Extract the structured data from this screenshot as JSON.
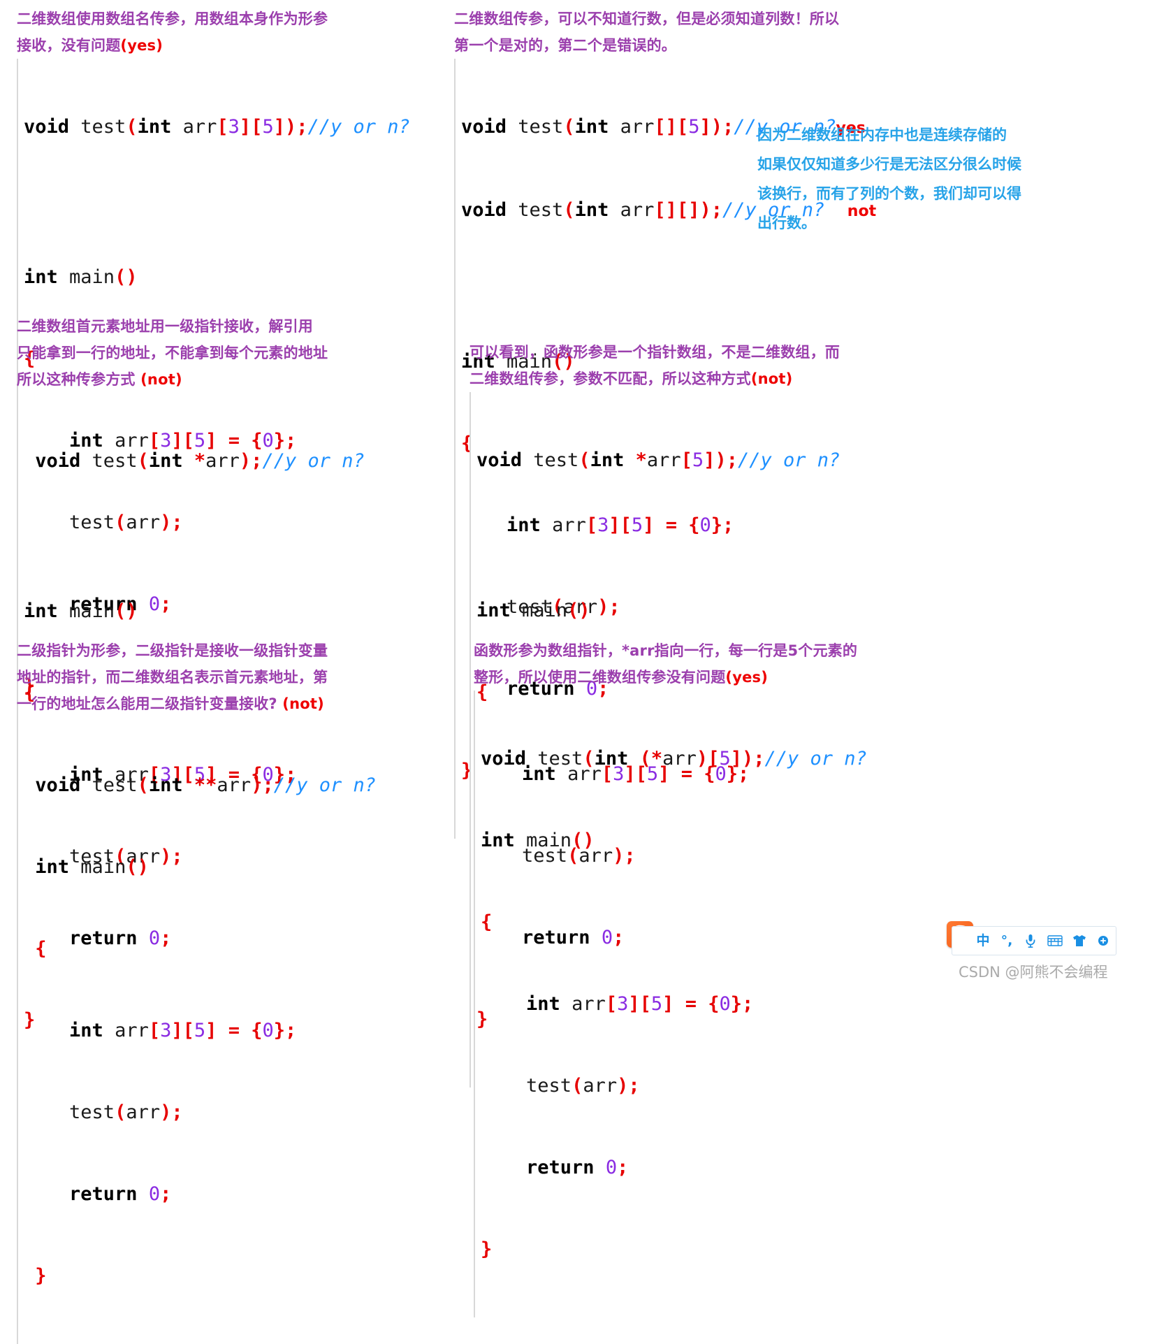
{
  "panels": [
    {
      "id": "top-left",
      "notes": [
        "二维数组使用数组名传参，用数组本身作为形参",
        "接收，没有问题"
      ],
      "note_tag": "(yes)",
      "signature": {
        "kw1": "void",
        "name": " test",
        "open": "(",
        "kw2": "int",
        "arg": " arr",
        "b1": "[",
        "n1": "3",
        "b2": "]",
        "b3": "[",
        "n2": "5",
        "b4": "]",
        "close": ");",
        "comment": "//y or n?"
      },
      "answer": "",
      "body": {
        "main_kw": "int",
        "main_name": " main",
        "main_paren": "()",
        "brace_open": "{",
        "decl_kw": "int",
        "decl_name": " arr",
        "decl_b1": "[",
        "decl_n1": "3",
        "decl_b2": "]",
        "decl_b3": "[",
        "decl_n2": "5",
        "decl_b4": "]",
        "decl_eq": " = ",
        "decl_init_open": "{",
        "decl_zero": "0",
        "decl_init_close": "};",
        "call_name": "test",
        "call_open": "(",
        "call_arg": "arr",
        "call_close": ");",
        "ret_kw": "return",
        "ret_val": " 0",
        "ret_semi": ";",
        "brace_close": "}"
      }
    },
    {
      "id": "top-right",
      "notes": [
        "二维数组传参，可以不知道行数，但是必须知道列数！所以",
        "第一个是对的，第二个是错误的。"
      ],
      "note_tag": "",
      "signature": {
        "kw1": "void",
        "name": " test",
        "open": "(",
        "kw2": "int",
        "arg": " arr",
        "b1": "[",
        "n1": "",
        "b2": "]",
        "b3": "[",
        "n2": "5",
        "b4": "]",
        "close": ");",
        "comment": "//y or n?"
      },
      "answer": "yes",
      "signature2": {
        "kw1": "void",
        "name": " test",
        "open": "(",
        "kw2": "int",
        "arg": " arr",
        "b1": "[",
        "n1": "",
        "b2": "]",
        "b3": "[",
        "n2": "",
        "b4": "]",
        "close": ");",
        "comment": "//y or n?"
      },
      "answer2": "not",
      "body": {
        "main_kw": "int",
        "main_name": " main",
        "main_paren": "()",
        "brace_open": "{",
        "decl_kw": "int",
        "decl_name": " arr",
        "decl_b1": "[",
        "decl_n1": "3",
        "decl_b2": "]",
        "decl_b3": "[",
        "decl_n2": "5",
        "decl_b4": "]",
        "decl_eq": " = ",
        "decl_init_open": "{",
        "decl_zero": "0",
        "decl_init_close": "};",
        "call_name": "test",
        "call_open": "(",
        "call_arg": "arr",
        "call_close": ");",
        "ret_kw": "return",
        "ret_val": " 0",
        "ret_semi": ";",
        "brace_close": "}"
      }
    },
    {
      "id": "mid-left",
      "notes": [
        "二维数组首元素地址用一级指针接收，解引用",
        "只能拿到一行的地址，不能拿到每个元素的地址",
        "所以这种传参方式 "
      ],
      "note_tag": "(not)",
      "signature": {
        "kw1": "void",
        "name": " test",
        "open": "(",
        "kw2": "int",
        "star": " *",
        "arg": "arr",
        "close": ");",
        "comment": "//y or n?"
      },
      "answer": "",
      "body": {
        "main_kw": "int",
        "main_name": " main",
        "main_paren": "()",
        "brace_open": "{",
        "decl_kw": "int",
        "decl_name": " arr",
        "decl_b1": "[",
        "decl_n1": "3",
        "decl_b2": "]",
        "decl_b3": "[",
        "decl_n2": "5",
        "decl_b4": "]",
        "decl_eq": " = ",
        "decl_init_open": "{",
        "decl_zero": "0",
        "decl_init_close": "};",
        "call_name": "test",
        "call_open": "(",
        "call_arg": "arr",
        "call_close": ");",
        "ret_kw": "return",
        "ret_val": " 0",
        "ret_semi": ";",
        "brace_close": "}"
      }
    },
    {
      "id": "mid-right",
      "notes": [
        "可以看到，函数形参是一个指针数组，不是二维数组，而",
        "二维数组传参，参数不匹配，所以这种方式"
      ],
      "note_tag": "(not)",
      "signature": {
        "kw1": "void",
        "name": " test",
        "open": "(",
        "kw2": "int",
        "star": " *",
        "arg": "arr",
        "b1": "[",
        "n1": "5",
        "b2": "]",
        "close": ");",
        "comment": "//y or n?"
      },
      "answer": "",
      "body": {
        "main_kw": "int",
        "main_name": " main",
        "main_paren": "()",
        "brace_open": "{",
        "decl_kw": "int",
        "decl_name": " arr",
        "decl_b1": "[",
        "decl_n1": "3",
        "decl_b2": "]",
        "decl_b3": "[",
        "decl_n2": "5",
        "decl_b4": "]",
        "decl_eq": " = ",
        "decl_init_open": "{",
        "decl_zero": "0",
        "decl_init_close": "};",
        "call_name": "test",
        "call_open": "(",
        "call_arg": "arr",
        "call_close": ");",
        "ret_kw": "return",
        "ret_val": " 0",
        "ret_semi": ";",
        "brace_close": "}"
      }
    },
    {
      "id": "bot-left",
      "notes": [
        "二级指针为形参，二级指针是接收一级指针变量",
        "地址的指针，而二维数组名表示首元素地址，第",
        "一行的地址怎么能用二级指针变量接收? "
      ],
      "note_tag": "(not)",
      "signature": {
        "kw1": "void",
        "name": " test",
        "open": "(",
        "kw2": "int",
        "star": " **",
        "arg": "arr",
        "close": ");",
        "comment": "//y or n?"
      },
      "answer": "",
      "body": {
        "main_kw": "int",
        "main_name": " main",
        "main_paren": "()",
        "brace_open": "{",
        "decl_kw": "int",
        "decl_name": " arr",
        "decl_b1": "[",
        "decl_n1": "3",
        "decl_b2": "]",
        "decl_b3": "[",
        "decl_n2": "5",
        "decl_b4": "]",
        "decl_eq": " = ",
        "decl_init_open": "{",
        "decl_zero": "0",
        "decl_init_close": "};",
        "call_name": "test",
        "call_open": "(",
        "call_arg": "arr",
        "call_close": ");",
        "ret_kw": "return",
        "ret_val": " 0",
        "ret_semi": ";",
        "brace_close": "}"
      }
    },
    {
      "id": "bot-right",
      "notes": [
        "函数形参为数组指针，*arr指向一行，每一行是5个元素的",
        "整形，所以使用二维数组传参没有问题"
      ],
      "note_tag": "(yes)",
      "signature": {
        "kw1": "void",
        "name": " test",
        "open": "(",
        "kw2": "int",
        "pstar": " (*",
        "arg": "arr",
        "pclose": ")",
        "b1": "[",
        "n1": "5",
        "b2": "]",
        "close": ");",
        "comment": "//y or n?"
      },
      "answer": "",
      "body": {
        "main_kw": "int",
        "main_name": " main",
        "main_paren": "()",
        "brace_open": "{",
        "decl_kw": "int",
        "decl_name": " arr",
        "decl_b1": "[",
        "decl_n1": "3",
        "decl_b2": "]",
        "decl_b3": "[",
        "decl_n2": "5",
        "decl_b4": "]",
        "decl_eq": " = ",
        "decl_init_open": "{",
        "decl_zero": "0",
        "decl_init_close": "};",
        "call_name": "test",
        "call_open": "(",
        "call_arg": "arr",
        "call_close": ");",
        "ret_kw": "return",
        "ret_val": " 0",
        "ret_semi": ";",
        "brace_close": "}"
      }
    }
  ],
  "blue_note": {
    "lines": [
      "因为二维数组在内存中也是连续存储的",
      "如果仅仅知道多少行是无法区分很么时候",
      "该换行，而有了列的个数，我们却可以得",
      "出行数。"
    ]
  },
  "ime_toolbar": {
    "logo": "S",
    "items": [
      {
        "name": "chinese-mode-icon",
        "glyph": "中"
      },
      {
        "name": "punctuation-icon",
        "glyph": "°,"
      },
      {
        "name": "microphone-icon",
        "glyph": ""
      },
      {
        "name": "soft-keyboard-icon",
        "glyph": ""
      },
      {
        "name": "skin-icon",
        "glyph": ""
      },
      {
        "name": "toolbox-icon",
        "glyph": ""
      }
    ]
  },
  "watermark": "CSDN @阿熊不会编程",
  "colors": {
    "note_purple": "#9b3fad",
    "answer_red": "#ee0000",
    "blue_note": "#27a3e8",
    "comment_blue": "#1e90ff",
    "punct_red": "#e60000",
    "number_purple": "#8a2be2",
    "ime_blue": "#1a8fe3",
    "ime_orange": "#f35b17",
    "watermark_gray": "#aaaaaa"
  }
}
